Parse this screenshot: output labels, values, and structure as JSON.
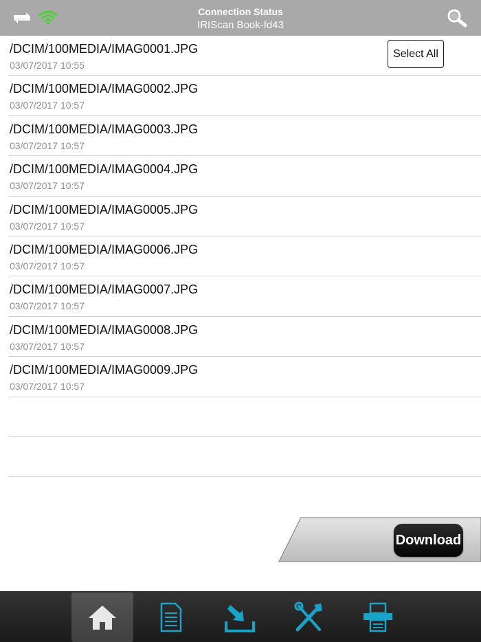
{
  "header": {
    "title": "Connection Status",
    "subtitle": "IRIScan Book-fd43",
    "icons": {
      "left": "sync-icon",
      "status": "wifi-icon",
      "right": "search-icon"
    },
    "wifi_color": "#4cd137"
  },
  "list": {
    "select_all_label": "Select All",
    "items": [
      {
        "path": "/DCIM/100MEDIA/IMAG0001.JPG",
        "date": "03/07/2017 10:55"
      },
      {
        "path": "/DCIM/100MEDIA/IMAG0002.JPG",
        "date": "03/07/2017 10:57"
      },
      {
        "path": "/DCIM/100MEDIA/IMAG0003.JPG",
        "date": "03/07/2017 10:57"
      },
      {
        "path": "/DCIM/100MEDIA/IMAG0004.JPG",
        "date": "03/07/2017 10:57"
      },
      {
        "path": "/DCIM/100MEDIA/IMAG0005.JPG",
        "date": "03/07/2017 10:57"
      },
      {
        "path": "/DCIM/100MEDIA/IMAG0006.JPG",
        "date": "03/07/2017 10:57"
      },
      {
        "path": "/DCIM/100MEDIA/IMAG0007.JPG",
        "date": "03/07/2017 10:57"
      },
      {
        "path": "/DCIM/100MEDIA/IMAG0008.JPG",
        "date": "03/07/2017 10:57"
      },
      {
        "path": "/DCIM/100MEDIA/IMAG0009.JPG",
        "date": "03/07/2017 10:57"
      }
    ]
  },
  "download": {
    "label": "Download"
  },
  "tabbar": {
    "accent": "#1aa3c9",
    "tabs": [
      {
        "icon": "home-icon",
        "active": true
      },
      {
        "icon": "document-icon",
        "active": false
      },
      {
        "icon": "download-tray-icon",
        "active": false
      },
      {
        "icon": "tools-icon",
        "active": false
      },
      {
        "icon": "scanner-icon",
        "active": false
      }
    ]
  }
}
